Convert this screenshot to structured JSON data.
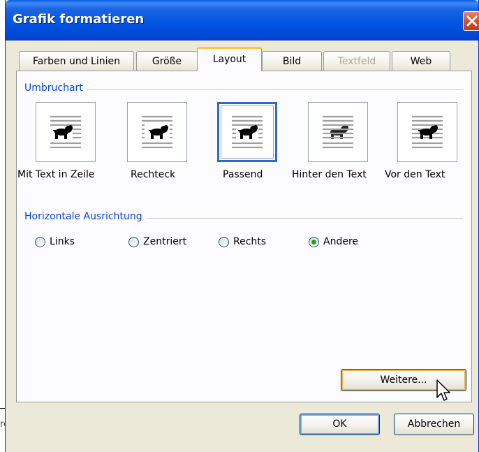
{
  "backdrop": {
    "fragment": "re"
  },
  "window": {
    "title": "Grafik formatieren"
  },
  "tabs": [
    {
      "label": "Farben und Linien",
      "state": "normal"
    },
    {
      "label": "Größe",
      "state": "normal"
    },
    {
      "label": "Layout",
      "state": "active"
    },
    {
      "label": "Bild",
      "state": "normal"
    },
    {
      "label": "Textfeld",
      "state": "disabled"
    },
    {
      "label": "Web",
      "state": "normal"
    }
  ],
  "wrap_group": {
    "title": "Umbruchart",
    "options": [
      {
        "label": "Mit Text in Zeile",
        "mnemonic": "M",
        "selected": false
      },
      {
        "label": "Rechteck",
        "mnemonic": "k",
        "selected": false
      },
      {
        "label": "Passend",
        "mnemonic": "P",
        "selected": true
      },
      {
        "label": "Hinter den Text",
        "mnemonic": "t",
        "selected": false
      },
      {
        "label": "Vor den Text",
        "mnemonic": "V",
        "selected": false
      }
    ]
  },
  "align_group": {
    "title": "Horizontale Ausrichtung",
    "options": [
      {
        "label": "Links",
        "mnemonic": "L",
        "checked": false
      },
      {
        "label": "Zentriert",
        "mnemonic": "Z",
        "checked": false
      },
      {
        "label": "Rechts",
        "mnemonic": "R",
        "checked": false
      },
      {
        "label": "Andere",
        "mnemonic": "A",
        "checked": true
      }
    ]
  },
  "buttons": {
    "more": "Weitere...",
    "ok": "OK",
    "cancel": "Abbrechen"
  },
  "colors": {
    "titlebar": "#0054E3",
    "accent": "#316AC5",
    "group_label": "#0046D5",
    "radio_dot": "#21A121",
    "tab_active_top": "#FFC83C"
  }
}
